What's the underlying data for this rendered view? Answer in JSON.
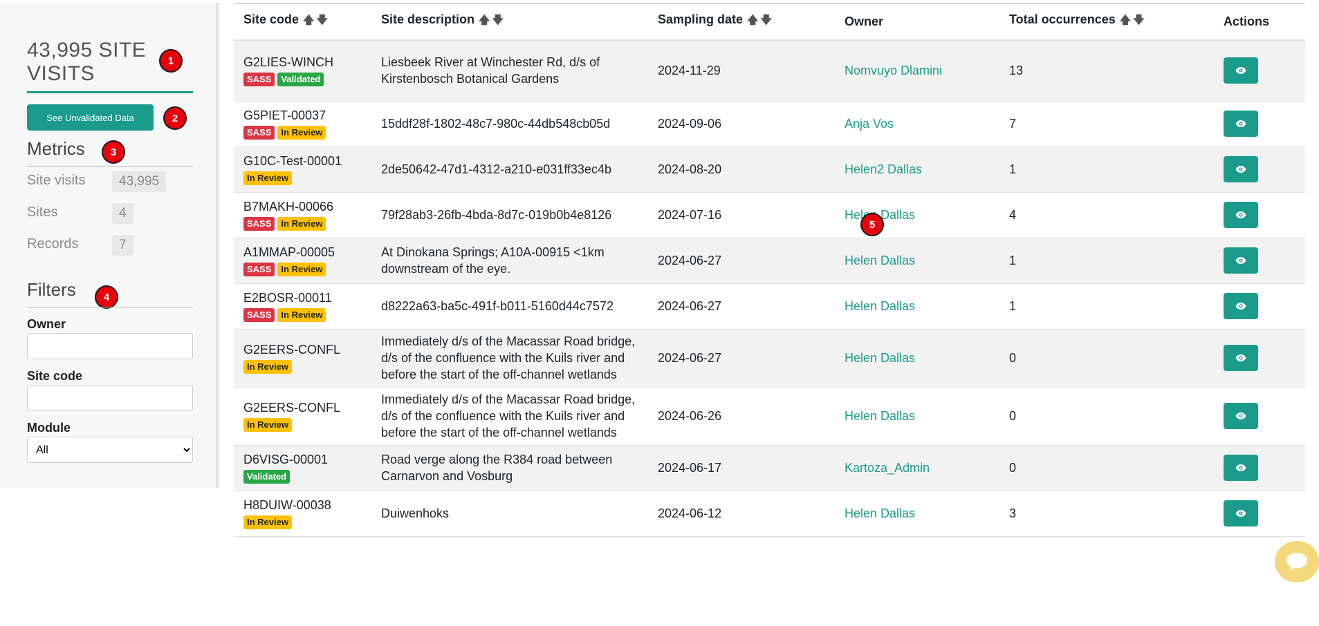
{
  "sidebar": {
    "title": "43,995 SITE VISITS",
    "unvalidated_button": "See Unvalidated Data",
    "metrics": {
      "title": "Metrics",
      "items": [
        {
          "label": "Site visits",
          "value": "43,995"
        },
        {
          "label": "Sites",
          "value": "4"
        },
        {
          "label": "Records",
          "value": "7"
        }
      ]
    },
    "filters": {
      "title": "Filters",
      "owner_label": "Owner",
      "owner_value": "",
      "site_code_label": "Site code",
      "site_code_value": "",
      "module_label": "Module",
      "module_selected": "All"
    }
  },
  "markers": [
    "1",
    "2",
    "3",
    "4",
    "5"
  ],
  "table": {
    "headers": {
      "site_code": "Site code",
      "site_description": "Site description",
      "sampling_date": "Sampling date",
      "owner": "Owner",
      "total_occurrences": "Total occurrences",
      "actions": "Actions"
    },
    "rows": [
      {
        "site_code": "G2LIES-WINCH",
        "badges": [
          "SASS",
          "Validated"
        ],
        "description": "Liesbeek River at Winchester Rd, d/s of Kirstenbosch Botanical Gardens",
        "date": "2024-11-29",
        "owner": "Nomvuyo Dlamini",
        "occurrences": "13"
      },
      {
        "site_code": "G5PIET-00037",
        "badges": [
          "SASS",
          "In Review"
        ],
        "description": "15ddf28f-1802-48c7-980c-44db548cb05d",
        "date": "2024-09-06",
        "owner": "Anja Vos",
        "occurrences": "7"
      },
      {
        "site_code": "G10C-Test-00001",
        "badges": [
          "In Review"
        ],
        "description": "2de50642-47d1-4312-a210-e031ff33ec4b",
        "date": "2024-08-20",
        "owner": "Helen2 Dallas",
        "occurrences": "1"
      },
      {
        "site_code": "B7MAKH-00066",
        "badges": [
          "SASS",
          "In Review"
        ],
        "description": "79f28ab3-26fb-4bda-8d7c-019b0b4e8126",
        "date": "2024-07-16",
        "owner": "Helen Dallas",
        "occurrences": "4"
      },
      {
        "site_code": "A1MMAP-00005",
        "badges": [
          "SASS",
          "In Review"
        ],
        "description": "At Dinokana Springs; A10A-00915 <1km downstream of the eye.",
        "date": "2024-06-27",
        "owner": "Helen Dallas",
        "occurrences": "1"
      },
      {
        "site_code": "E2BOSR-00011",
        "badges": [
          "SASS",
          "In Review"
        ],
        "description": "d8222a63-ba5c-491f-b011-5160d44c7572",
        "date": "2024-06-27",
        "owner": "Helen Dallas",
        "occurrences": "1"
      },
      {
        "site_code": "G2EERS-CONFL",
        "badges": [
          "In Review"
        ],
        "description": "Immediately d/s of the Macassar Road bridge, d/s of the confluence with the Kuils river and before the start of the off-channel wetlands",
        "date": "2024-06-27",
        "owner": "Helen Dallas",
        "occurrences": "0"
      },
      {
        "site_code": "G2EERS-CONFL",
        "badges": [
          "In Review"
        ],
        "description": "Immediately d/s of the Macassar Road bridge, d/s of the confluence with the Kuils river and before the start of the off-channel wetlands",
        "date": "2024-06-26",
        "owner": "Helen Dallas",
        "occurrences": "0"
      },
      {
        "site_code": "D6VISG-00001",
        "badges": [
          "Validated"
        ],
        "description": "Road verge along the R384 road between Carnarvon and Vosburg",
        "date": "2024-06-17",
        "owner": "Kartoza_Admin",
        "occurrences": "0"
      },
      {
        "site_code": "H8DUIW-00038",
        "badges": [
          "In Review"
        ],
        "description": "Duiwenhoks",
        "date": "2024-06-12",
        "owner": "Helen Dallas",
        "occurrences": "3"
      }
    ]
  },
  "colors": {
    "accent": "#1a9b8c",
    "sass": "#dc3545",
    "in_review": "#ffc107",
    "validated": "#28a745",
    "marker": "#e8000b"
  }
}
